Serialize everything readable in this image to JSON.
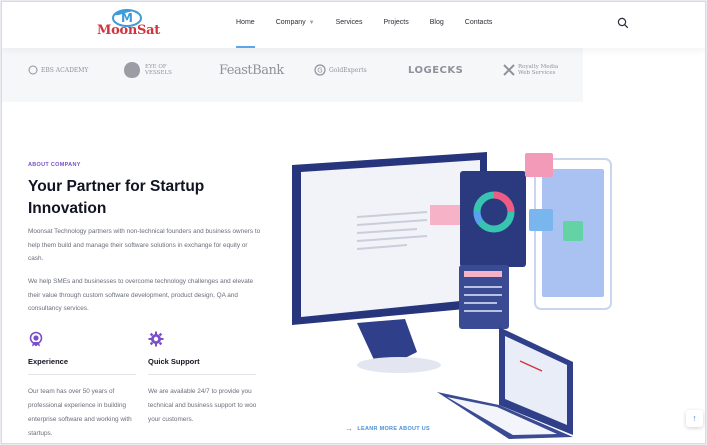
{
  "header": {
    "logo_text": "MoonSat",
    "logo_mark": "M",
    "nav": [
      {
        "label": "Home",
        "active": true
      },
      {
        "label": "Company",
        "has_dropdown": true
      },
      {
        "label": "Services"
      },
      {
        "label": "Projects"
      },
      {
        "label": "Blog"
      },
      {
        "label": "Contacts"
      }
    ],
    "search_icon": "search-icon",
    "accent_color": "#5ba7e8"
  },
  "brands": [
    {
      "name": "EBS ACADEMY"
    },
    {
      "name": "EYE OF VESSELS"
    },
    {
      "name": "FeastBank"
    },
    {
      "name": "GoldExperts"
    },
    {
      "name": "LOGECKS"
    },
    {
      "name": "Royalty Media Web Services"
    }
  ],
  "about": {
    "eyebrow": "ABOUT COMPANY",
    "eyebrow_color": "#7a4fc9",
    "headline": "Your Partner for Startup Innovation",
    "paragraph1": "Moonsat Technology partners with non-technical founders and business owners to help them build and manage their software solutions in exchange for equity or cash.",
    "paragraph2": "We help SMEs and businesses to overcome technology challenges and elevate their value through custom software development, product design, QA and consultancy services.",
    "features": [
      {
        "icon": "medal-icon",
        "title": "Experience",
        "text": "Our team has over 50 years of professional experience in building enterprise software and working with startups."
      },
      {
        "icon": "gear-icon",
        "title": "Quick Support",
        "text": "We are available 24/7 to provide you technical and business support to woo your customers."
      }
    ],
    "cta": "LEANR MORE ABOUT US",
    "cta_icon": "arrow-right-icon"
  },
  "scroll_top_icon": "arrow-up-icon"
}
